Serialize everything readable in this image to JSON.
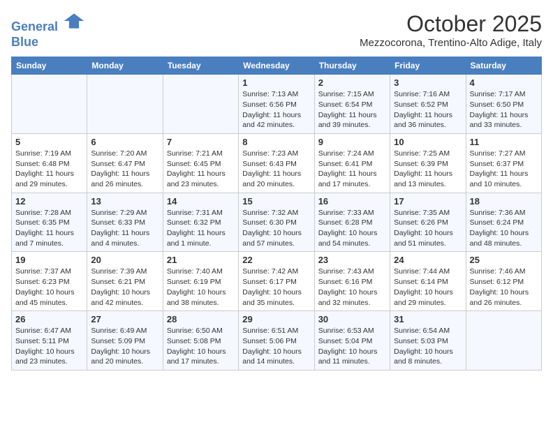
{
  "header": {
    "logo_line1": "General",
    "logo_line2": "Blue",
    "month": "October 2025",
    "location": "Mezzocorona, Trentino-Alto Adige, Italy"
  },
  "days_of_week": [
    "Sunday",
    "Monday",
    "Tuesday",
    "Wednesday",
    "Thursday",
    "Friday",
    "Saturday"
  ],
  "weeks": [
    [
      {
        "num": "",
        "info": ""
      },
      {
        "num": "",
        "info": ""
      },
      {
        "num": "",
        "info": ""
      },
      {
        "num": "1",
        "info": "Sunrise: 7:13 AM\nSunset: 6:56 PM\nDaylight: 11 hours and 42 minutes."
      },
      {
        "num": "2",
        "info": "Sunrise: 7:15 AM\nSunset: 6:54 PM\nDaylight: 11 hours and 39 minutes."
      },
      {
        "num": "3",
        "info": "Sunrise: 7:16 AM\nSunset: 6:52 PM\nDaylight: 11 hours and 36 minutes."
      },
      {
        "num": "4",
        "info": "Sunrise: 7:17 AM\nSunset: 6:50 PM\nDaylight: 11 hours and 33 minutes."
      }
    ],
    [
      {
        "num": "5",
        "info": "Sunrise: 7:19 AM\nSunset: 6:48 PM\nDaylight: 11 hours and 29 minutes."
      },
      {
        "num": "6",
        "info": "Sunrise: 7:20 AM\nSunset: 6:47 PM\nDaylight: 11 hours and 26 minutes."
      },
      {
        "num": "7",
        "info": "Sunrise: 7:21 AM\nSunset: 6:45 PM\nDaylight: 11 hours and 23 minutes."
      },
      {
        "num": "8",
        "info": "Sunrise: 7:23 AM\nSunset: 6:43 PM\nDaylight: 11 hours and 20 minutes."
      },
      {
        "num": "9",
        "info": "Sunrise: 7:24 AM\nSunset: 6:41 PM\nDaylight: 11 hours and 17 minutes."
      },
      {
        "num": "10",
        "info": "Sunrise: 7:25 AM\nSunset: 6:39 PM\nDaylight: 11 hours and 13 minutes."
      },
      {
        "num": "11",
        "info": "Sunrise: 7:27 AM\nSunset: 6:37 PM\nDaylight: 11 hours and 10 minutes."
      }
    ],
    [
      {
        "num": "12",
        "info": "Sunrise: 7:28 AM\nSunset: 6:35 PM\nDaylight: 11 hours and 7 minutes."
      },
      {
        "num": "13",
        "info": "Sunrise: 7:29 AM\nSunset: 6:33 PM\nDaylight: 11 hours and 4 minutes."
      },
      {
        "num": "14",
        "info": "Sunrise: 7:31 AM\nSunset: 6:32 PM\nDaylight: 11 hours and 1 minute."
      },
      {
        "num": "15",
        "info": "Sunrise: 7:32 AM\nSunset: 6:30 PM\nDaylight: 10 hours and 57 minutes."
      },
      {
        "num": "16",
        "info": "Sunrise: 7:33 AM\nSunset: 6:28 PM\nDaylight: 10 hours and 54 minutes."
      },
      {
        "num": "17",
        "info": "Sunrise: 7:35 AM\nSunset: 6:26 PM\nDaylight: 10 hours and 51 minutes."
      },
      {
        "num": "18",
        "info": "Sunrise: 7:36 AM\nSunset: 6:24 PM\nDaylight: 10 hours and 48 minutes."
      }
    ],
    [
      {
        "num": "19",
        "info": "Sunrise: 7:37 AM\nSunset: 6:23 PM\nDaylight: 10 hours and 45 minutes."
      },
      {
        "num": "20",
        "info": "Sunrise: 7:39 AM\nSunset: 6:21 PM\nDaylight: 10 hours and 42 minutes."
      },
      {
        "num": "21",
        "info": "Sunrise: 7:40 AM\nSunset: 6:19 PM\nDaylight: 10 hours and 38 minutes."
      },
      {
        "num": "22",
        "info": "Sunrise: 7:42 AM\nSunset: 6:17 PM\nDaylight: 10 hours and 35 minutes."
      },
      {
        "num": "23",
        "info": "Sunrise: 7:43 AM\nSunset: 6:16 PM\nDaylight: 10 hours and 32 minutes."
      },
      {
        "num": "24",
        "info": "Sunrise: 7:44 AM\nSunset: 6:14 PM\nDaylight: 10 hours and 29 minutes."
      },
      {
        "num": "25",
        "info": "Sunrise: 7:46 AM\nSunset: 6:12 PM\nDaylight: 10 hours and 26 minutes."
      }
    ],
    [
      {
        "num": "26",
        "info": "Sunrise: 6:47 AM\nSunset: 5:11 PM\nDaylight: 10 hours and 23 minutes."
      },
      {
        "num": "27",
        "info": "Sunrise: 6:49 AM\nSunset: 5:09 PM\nDaylight: 10 hours and 20 minutes."
      },
      {
        "num": "28",
        "info": "Sunrise: 6:50 AM\nSunset: 5:08 PM\nDaylight: 10 hours and 17 minutes."
      },
      {
        "num": "29",
        "info": "Sunrise: 6:51 AM\nSunset: 5:06 PM\nDaylight: 10 hours and 14 minutes."
      },
      {
        "num": "30",
        "info": "Sunrise: 6:53 AM\nSunset: 5:04 PM\nDaylight: 10 hours and 11 minutes."
      },
      {
        "num": "31",
        "info": "Sunrise: 6:54 AM\nSunset: 5:03 PM\nDaylight: 10 hours and 8 minutes."
      },
      {
        "num": "",
        "info": ""
      }
    ]
  ]
}
